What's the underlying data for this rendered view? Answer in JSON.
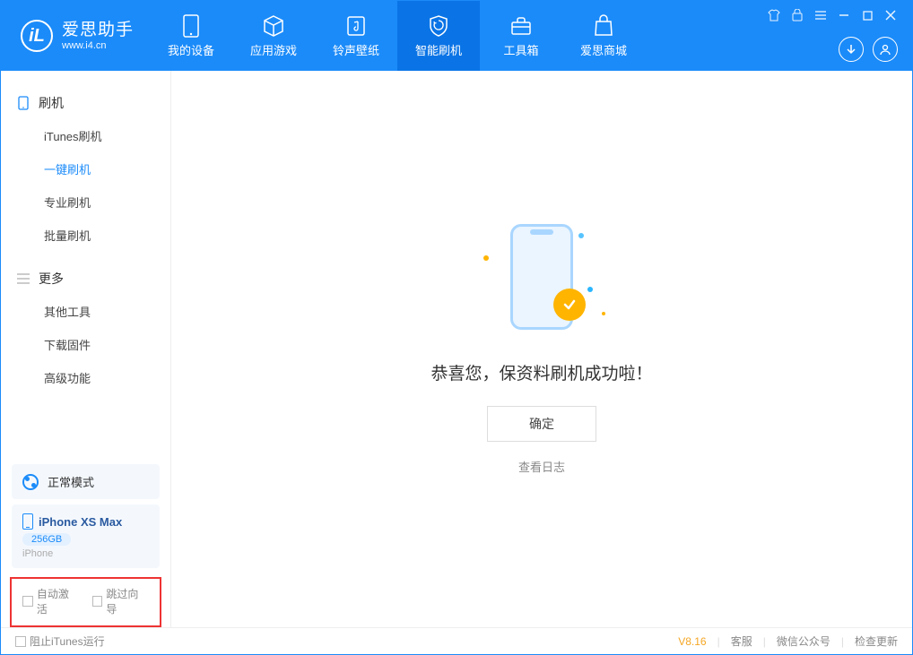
{
  "app": {
    "title": "爱思助手",
    "url": "www.i4.cn"
  },
  "nav": {
    "device": "我的设备",
    "apps": "应用游戏",
    "ringtones": "铃声壁纸",
    "flash": "智能刷机",
    "toolbox": "工具箱",
    "store": "爱思商城"
  },
  "sidebar": {
    "group1_title": "刷机",
    "items1": {
      "itunes": "iTunes刷机",
      "oneclick": "一键刷机",
      "pro": "专业刷机",
      "batch": "批量刷机"
    },
    "group2_title": "更多",
    "items2": {
      "other": "其他工具",
      "firmware": "下载固件",
      "advanced": "高级功能"
    },
    "mode_label": "正常模式",
    "device_name": "iPhone XS Max",
    "device_storage": "256GB",
    "device_type": "iPhone",
    "auto_activate": "自动激活",
    "skip_guide": "跳过向导"
  },
  "main": {
    "success_text": "恭喜您，保资料刷机成功啦！",
    "ok_button": "确定",
    "view_log": "查看日志"
  },
  "footer": {
    "stop_itunes": "阻止iTunes运行",
    "version": "V8.16",
    "support": "客服",
    "wechat": "微信公众号",
    "update": "检查更新"
  }
}
